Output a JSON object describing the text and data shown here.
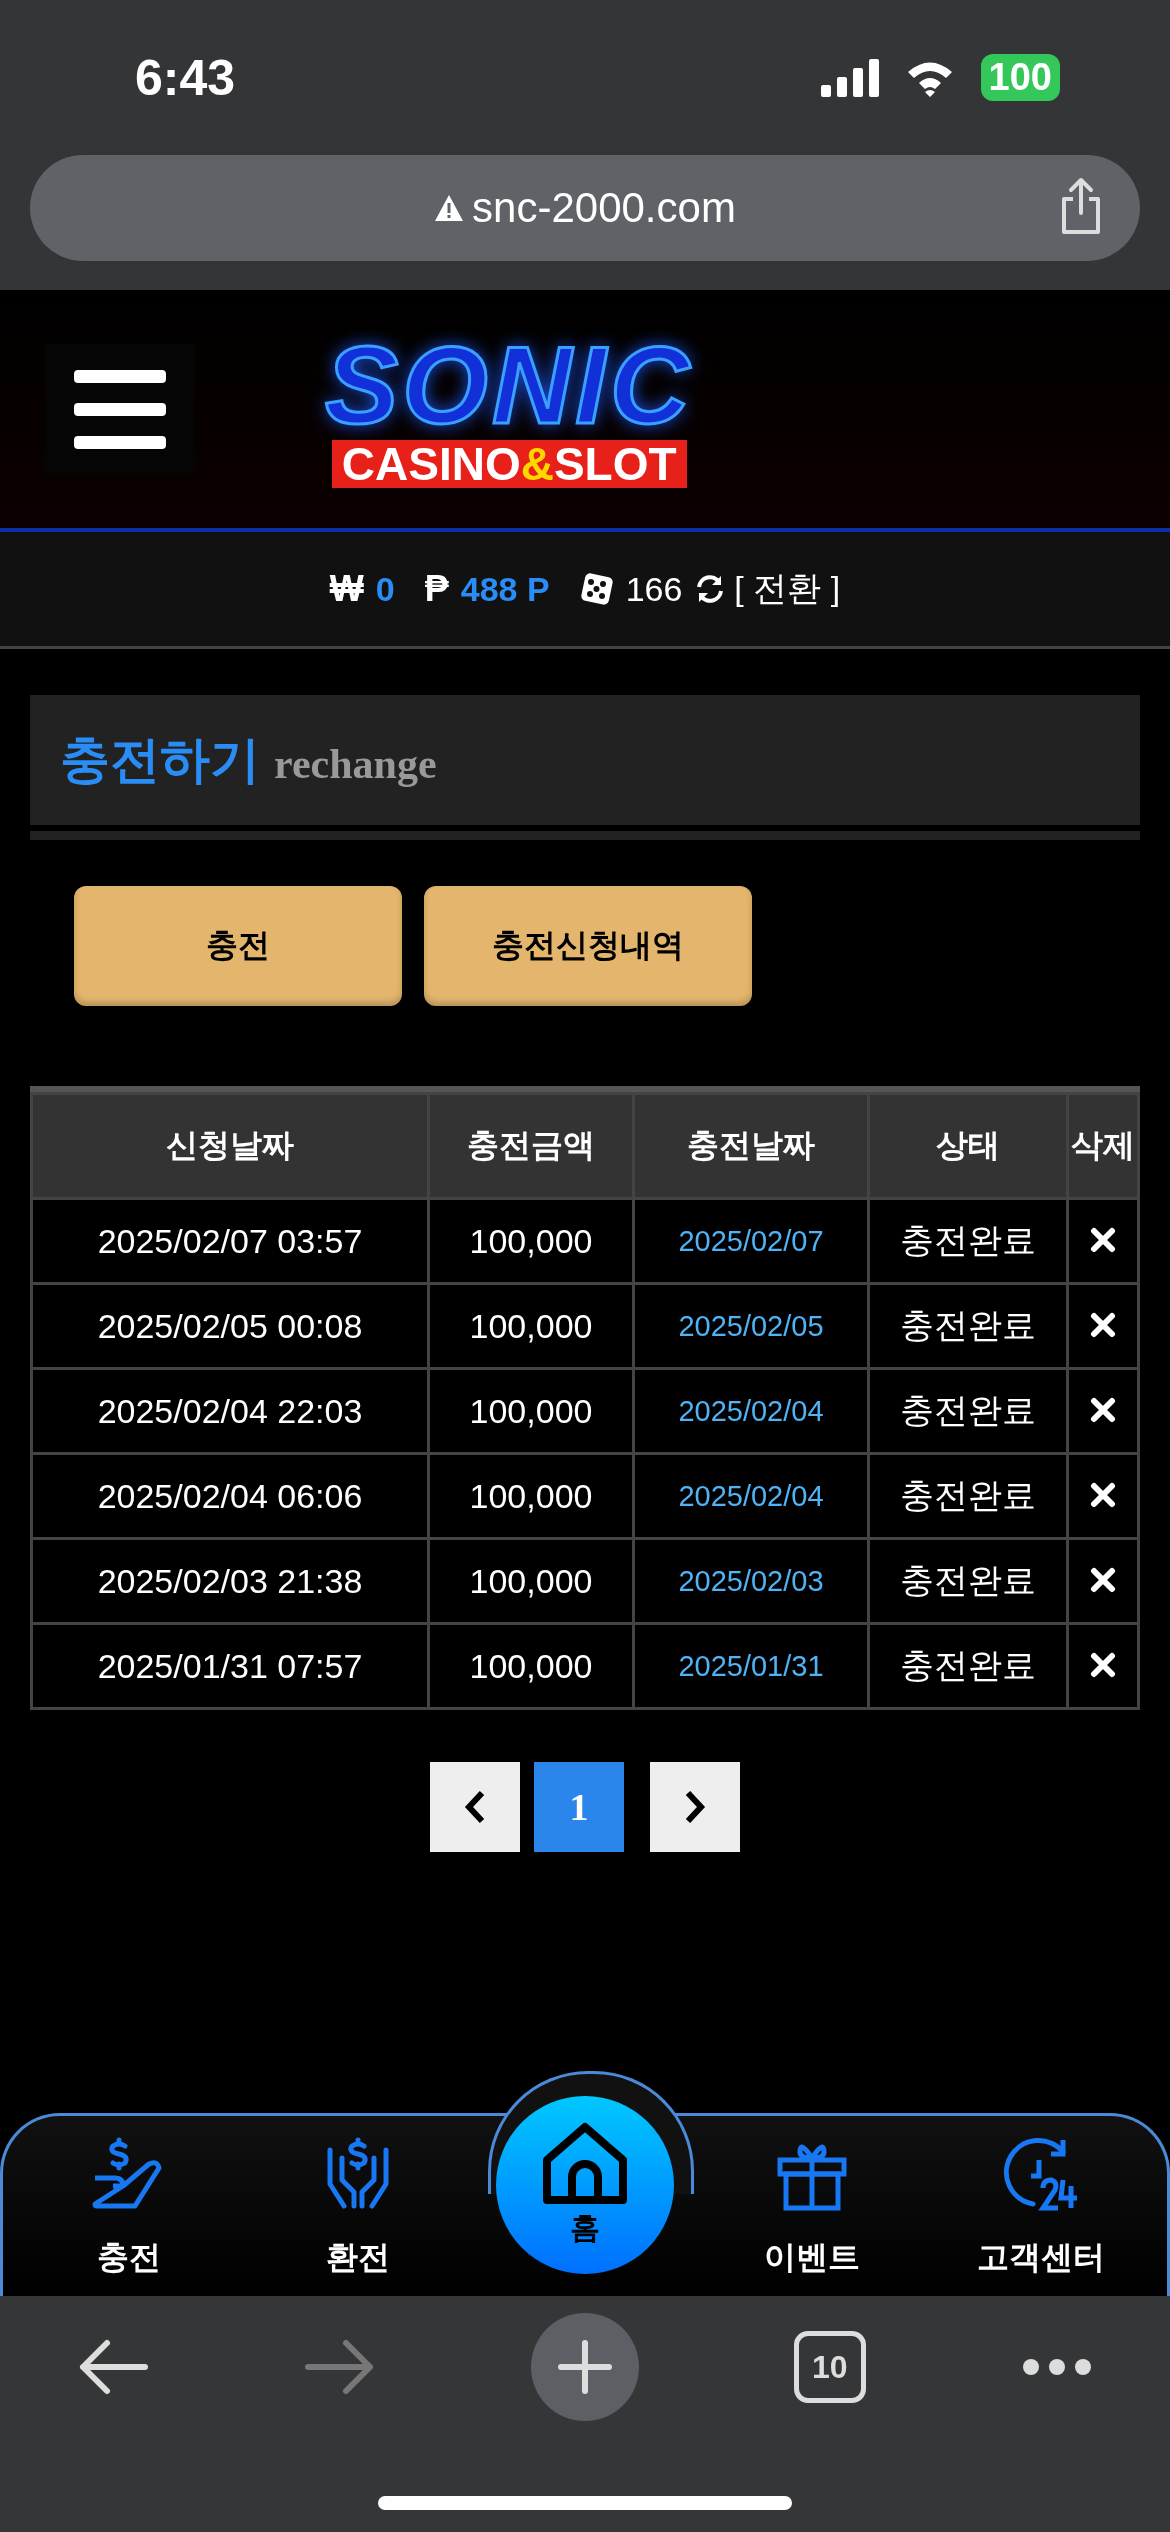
{
  "status_bar": {
    "time": "6:43",
    "battery": "100"
  },
  "browser": {
    "url": "snc-2000.com",
    "tab_count": "10"
  },
  "logo": {
    "title": "SONIC",
    "subtitle": [
      {
        "text": "CASINO",
        "kind": "plain"
      },
      {
        "text": "&",
        "kind": "accent"
      },
      {
        "text": "SLOT",
        "kind": "plain"
      }
    ]
  },
  "balance": {
    "items": [
      {
        "kind": "won",
        "symbol": "₩",
        "value": "0"
      },
      {
        "kind": "point",
        "symbol": "₱",
        "value": "488 P"
      },
      {
        "kind": "dice",
        "value": "166"
      }
    ],
    "convert": "[ 전환 ]"
  },
  "page_title": {
    "title": "충전하기",
    "subtitle": "rechange"
  },
  "actions": [
    "충전",
    "충전신청내역"
  ],
  "table": {
    "columns": [
      "신청날짜",
      "충전금액",
      "충전날짜",
      "상태",
      "삭제"
    ],
    "rows": [
      {
        "requested": "2025/02/07 03:57",
        "amount": "100,000",
        "charged": "2025/02/07",
        "status": "충전완료"
      },
      {
        "requested": "2025/02/05 00:08",
        "amount": "100,000",
        "charged": "2025/02/05",
        "status": "충전완료"
      },
      {
        "requested": "2025/02/04 22:03",
        "amount": "100,000",
        "charged": "2025/02/04",
        "status": "충전완료"
      },
      {
        "requested": "2025/02/04 06:06",
        "amount": "100,000",
        "charged": "2025/02/04",
        "status": "충전완료"
      },
      {
        "requested": "2025/02/03 21:38",
        "amount": "100,000",
        "charged": "2025/02/03",
        "status": "충전완료"
      },
      {
        "requested": "2025/01/31 07:57",
        "amount": "100,000",
        "charged": "2025/01/31",
        "status": "충전완료"
      }
    ]
  },
  "pagination": {
    "pages": [
      {
        "label": "1",
        "selected": true
      }
    ]
  },
  "bottom_nav": [
    {
      "kind": "charge",
      "label": "충전"
    },
    {
      "kind": "exchange",
      "label": "환전"
    },
    {
      "kind": "home",
      "label": "홈"
    },
    {
      "kind": "event",
      "label": "이벤트"
    },
    {
      "kind": "support",
      "label": "고객센터"
    }
  ]
}
